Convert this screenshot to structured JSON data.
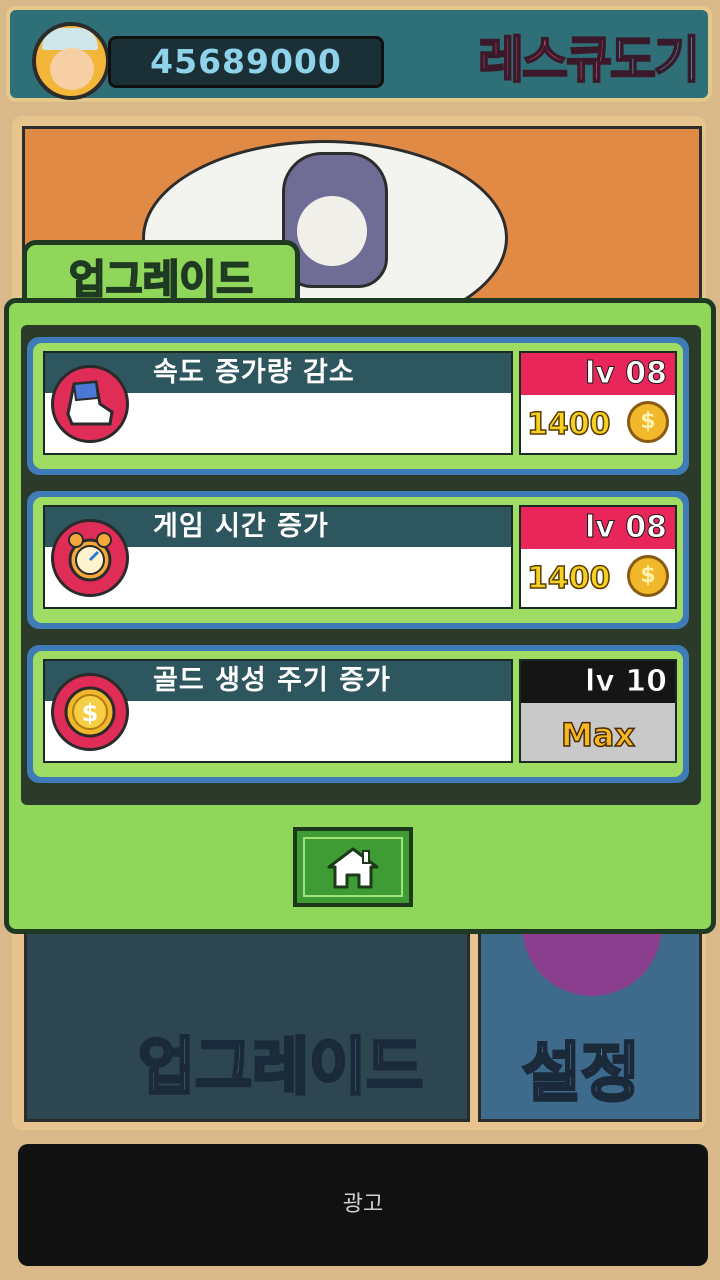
{
  "header": {
    "coins": "45689000",
    "logo_part1": "레스큐",
    "logo_part2": "도기"
  },
  "modal": {
    "tab_label": "업그레이드",
    "items": [
      {
        "title": "속도 증가량 감소",
        "level": "lv 08",
        "cost": "1400",
        "icon": "sneaker-icon"
      },
      {
        "title": "게임 시간 증가",
        "level": "lv 08",
        "cost": "1400",
        "icon": "alarm-clock-icon"
      },
      {
        "title": "골드 생성 주기 증가",
        "level": "lv 10",
        "max_label": "Max",
        "icon": "gold-coin-icon"
      }
    ],
    "coin_symbol": "$",
    "home_icon": "home-icon"
  },
  "background_menu": {
    "upgrade_label": "업그레이드",
    "settings_label": "설정"
  },
  "ad": {
    "label": "광고"
  },
  "colors": {
    "panel_green": "#8fd65a",
    "item_blue": "#3f7bb7",
    "level_red": "#e8265a",
    "title_teal": "#2e565e",
    "coin_gold": "#f1b82c"
  }
}
